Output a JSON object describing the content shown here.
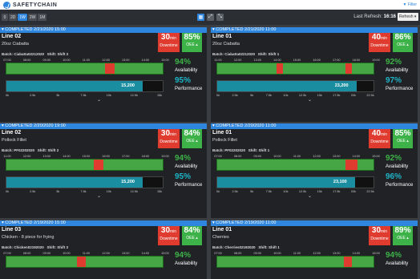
{
  "header": {
    "logo_text": "SAFETYCHAIN",
    "filter_label": "Filter"
  },
  "toolbar": {
    "ranges": [
      "0",
      "2D",
      "1W",
      "2W",
      "1M"
    ],
    "active_range": "1W",
    "last_refresh_label": "Last Refresh:",
    "last_refresh_time": "16:16",
    "refresh_select": "Refresh ▾"
  },
  "hour_ticks": [
    "07:00",
    "08:00",
    "09:00",
    "10:00",
    "11:00",
    "12:00",
    "13:00",
    "14:00",
    "15:00"
  ],
  "hour_ticks_b": [
    "11:00",
    "12:00",
    "13:00",
    "14:00",
    "15:00",
    "16:00",
    "17:00",
    "18:00",
    "19:00"
  ],
  "count_ticks": [
    "0k",
    "2.5k",
    "5k",
    "7.5k",
    "10k",
    "12.5k",
    "15k"
  ],
  "count_ticks_b": [
    "0k",
    "2.5k",
    "5k",
    "7.5k",
    "10k",
    "12.5k",
    "15k",
    "17.5k",
    "20k",
    "22.5k"
  ],
  "cards": [
    {
      "status": "COMPLETED 2/21/2020 15:00",
      "line": "Line 02",
      "product": "20oz Ciabatta",
      "downtime": "30",
      "downtime_unit": "min",
      "downtime_label": "Downtime",
      "oee": "85%",
      "oee_label": "OEE ▴",
      "batch": "Batch: Ciabatta02212020",
      "shift": "Shift: Shift 2",
      "availability": "94%",
      "availability_label": "Availability",
      "performance": "95%",
      "performance_label": "Performance",
      "perf_value": "15,200",
      "perf_fill": 0.95,
      "downtime_segments": [
        [
          0.63,
          0.69
        ]
      ],
      "ticks": "a",
      "counts": "a"
    },
    {
      "status": "COMPLETED 2/21/2020 11:00",
      "line": "Line 01",
      "product": "20oz Ciabatta",
      "downtime": "40",
      "downtime_unit": "min",
      "downtime_label": "Downtime",
      "oee": "86%",
      "oee_label": "OEE ▴",
      "batch": "Batch: Ciabatta02212020",
      "shift": "Shift: Shift 1",
      "availability": "92%",
      "availability_label": "Availability",
      "performance": "97%",
      "performance_label": "Performance",
      "perf_value": "23,200",
      "perf_fill": 0.97,
      "downtime_segments": [
        [
          0.38,
          0.42
        ],
        [
          0.82,
          0.86
        ]
      ],
      "ticks": "b",
      "counts": "b"
    },
    {
      "status": "COMPLETED 2/20/2020 19:00",
      "line": "Line 02",
      "product": "Pollock Fillet",
      "downtime": "30",
      "downtime_unit": "min",
      "downtime_label": "Downtime",
      "oee": "84%",
      "oee_label": "OEE ▴",
      "batch": "Batch: PF02202020",
      "shift": "Shift: Shift 2",
      "availability": "94%",
      "availability_label": "Availability",
      "performance": "95%",
      "performance_label": "Performance",
      "perf_value": "15,200",
      "perf_fill": 0.95,
      "downtime_segments": [
        [
          0.56,
          0.62
        ]
      ],
      "ticks": "b",
      "counts": "a"
    },
    {
      "status": "COMPLETED 2/20/2020 11:00",
      "line": "Line 01",
      "product": "Pollock Fillet",
      "downtime": "40",
      "downtime_unit": "min",
      "downtime_label": "Downtime",
      "oee": "85%",
      "oee_label": "OEE ▴",
      "batch": "Batch: PF02202020",
      "shift": "Shift: Shift 1",
      "availability": "92%",
      "availability_label": "Availability",
      "performance": "96%",
      "performance_label": "Performance",
      "perf_value": "23,100",
      "perf_fill": 0.96,
      "downtime_segments": [
        [
          0.82,
          0.9
        ]
      ],
      "ticks": "a",
      "counts": "b"
    },
    {
      "status": "COMPLETED 2/19/2020 15:00",
      "line": "Line 03",
      "product": "Chicken - 8 piece for frying",
      "downtime": "30",
      "downtime_unit": "min",
      "downtime_label": "Downtime",
      "oee": "84%",
      "oee_label": "OEE ▴",
      "batch": "Batch: Chicken02192020",
      "shift": "Shift: Shift 3",
      "availability": "94%",
      "availability_label": "Availability",
      "performance": "",
      "performance_label": "",
      "perf_value": "",
      "perf_fill": 0,
      "downtime_segments": [
        [
          0.45,
          0.51
        ]
      ],
      "ticks": "a",
      "counts": "a"
    },
    {
      "status": "COMPLETED 2/19/2020 11:00",
      "line": "Line 01",
      "product": "Cherries",
      "downtime": "30",
      "downtime_unit": "min",
      "downtime_label": "Downtime",
      "oee": "89%",
      "oee_label": "OEE ▴",
      "batch": "Batch: Cherries02192020",
      "shift": "Shift: Shift 1",
      "availability": "94%",
      "availability_label": "Availability",
      "performance": "",
      "performance_label": "",
      "perf_value": "",
      "perf_fill": 0,
      "downtime_segments": [
        [
          0.81,
          0.86
        ]
      ],
      "ticks": "a",
      "counts": "b"
    }
  ],
  "colors": {
    "accent": "#2e86de",
    "downtime": "#e03b2f",
    "good": "#3db249",
    "performance": "#1a8ea0"
  }
}
